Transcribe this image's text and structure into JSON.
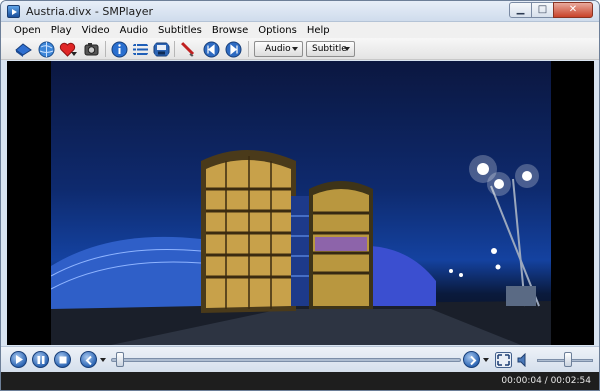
{
  "window": {
    "title": "Austria.divx - SMPlayer"
  },
  "window_buttons": {
    "minimize": "▁",
    "maximize": "□",
    "close": "✕"
  },
  "menu": [
    "Open",
    "Play",
    "Video",
    "Audio",
    "Subtitles",
    "Browse",
    "Options",
    "Help"
  ],
  "toolbar": {
    "icons": [
      "open-file-icon",
      "open-url-icon",
      "favorites-icon",
      "screenshot-icon",
      "info-icon",
      "playlist-icon",
      "preferences-icon",
      "equalizer-icon",
      "previous-chapter-icon",
      "next-chapter-icon"
    ],
    "audio_label": "Audio",
    "subtitle_label": "Subtitle"
  },
  "playback": {
    "position_fraction": 0.026,
    "volume_fraction": 0.55
  },
  "status": {
    "time_display": "00:00:04 / 00:02:54"
  },
  "colors": {
    "window_frame": "#d9e4f1",
    "accent_blue": "#2e67b5",
    "status_bg": "#1e1e1e"
  }
}
